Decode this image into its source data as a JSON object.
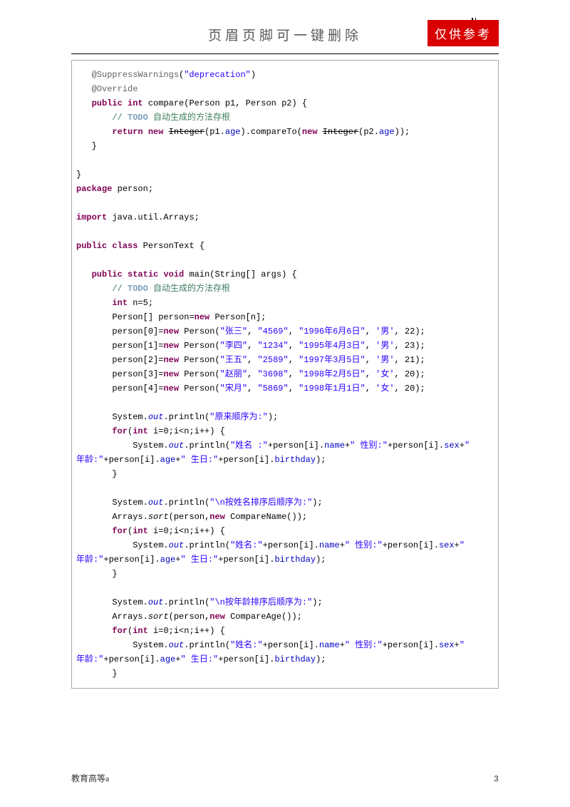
{
  "header": {
    "title": "页眉页脚可一键删除",
    "stamp": "仅供参考"
  },
  "code": {
    "l1_ann": "@SuppressWarnings",
    "l1_str": "\"deprecation\"",
    "l2_ann": "@Override",
    "l3_kw1": "public",
    "l3_kw2": "int",
    "l3_txt": " compare(Person p1, Person p2) {",
    "l4_todo": "TODO",
    "l4_cmt": " 自动生成的方法存根",
    "l5_kw1": "return",
    "l5_kw2": "new",
    "l5_cls1": "Integer",
    "l5_txt1": "(p1.",
    "l5_fld1": "age",
    "l5_txt2": ").compareTo(",
    "l5_kw3": "new",
    "l5_cls2": "Integer",
    "l5_txt3": "(p2.",
    "l5_fld2": "age",
    "l5_txt4": "));",
    "l7_kw": "package",
    "l7_txt": " person;",
    "l8_kw": "import",
    "l8_txt": " java.util.Arrays;",
    "l9_kw1": "public",
    "l9_kw2": "class",
    "l9_txt": " PersonText {",
    "l10_kw1": "public",
    "l10_kw2": "static",
    "l10_kw3": "void",
    "l10_txt": " main(String[] args) {",
    "l11_todo": "TODO",
    "l11_cmt": " 自动生成的方法存根",
    "l12_kw": "int",
    "l12_txt": " n=5;",
    "l13_txt1": "Person[] person=",
    "l13_kw": "new",
    "l13_txt2": " Person[n];",
    "p0_a": "person[0]=",
    "p0_kw": "new",
    "p0_b": " Person(",
    "p0_s1": "\"张三\"",
    "p0_s2": "\"4569\"",
    "p0_s3": "\"1996年6月6日\"",
    "p0_s4": "'男'",
    "p0_n": ", 22);",
    "p1_a": "person[1]=",
    "p1_kw": "new",
    "p1_b": " Person(",
    "p1_s1": "\"李四\"",
    "p1_s2": "\"1234\"",
    "p1_s3": "\"1995年4月3日\"",
    "p1_s4": "'男'",
    "p1_n": ", 23);",
    "p2_a": "person[2]=",
    "p2_kw": "new",
    "p2_b": " Person(",
    "p2_s1": "\"王五\"",
    "p2_s2": "\"2589\"",
    "p2_s3": "\"1997年3月5日\"",
    "p2_s4": "'男'",
    "p2_n": ", 21);",
    "p3_a": "person[3]=",
    "p3_kw": "new",
    "p3_b": " Person(",
    "p3_s1": "\"赵丽\"",
    "p3_s2": "\"3698\"",
    "p3_s3": "\"1998年2月5日\"",
    "p3_s4": "'女'",
    "p3_n": ", 20);",
    "p4_a": "person[4]=",
    "p4_kw": "new",
    "p4_b": " Person(",
    "p4_s1": "\"宋月\"",
    "p4_s2": "\"5869\"",
    "p4_s3": "\"1998年1月1日\"",
    "p4_s4": "'女'",
    "p4_n": ", 20);",
    "so": "System.",
    "out": "out",
    "pln": ".println(",
    "str_orig": "\"原来顺序为:\"",
    "for_kw": "for",
    "for_int": "int",
    "for_txt": " i=0;i<n;i++) {",
    "str_name_lbl": "\"姓名 :\"",
    "str_name_lbl2": "\"姓名:\"",
    "plus_p": "+person[i].",
    "name": "name",
    "str_sex": "\" 性别:\"",
    "sex": "sex",
    "str_age_c": "年龄:\"",
    "age": "age",
    "str_bday": "\" 生日:\"",
    "bday": "birthday",
    "str_byname": "\"\\n按姓名排序后顺序为:\"",
    "arr_sort": "Arrays.",
    "sort": "sort",
    "arr_a": "(person,",
    "new_kw": "new",
    "cmpName": " CompareName());",
    "cmpAge": " CompareAge());",
    "str_byage": "\"\\n按年龄排序后顺序为:\"",
    "plus": "+",
    "q": "\"",
    "close_p": ");",
    "close_b": "}"
  },
  "footer": {
    "left": "教育高等a",
    "right": "3"
  }
}
